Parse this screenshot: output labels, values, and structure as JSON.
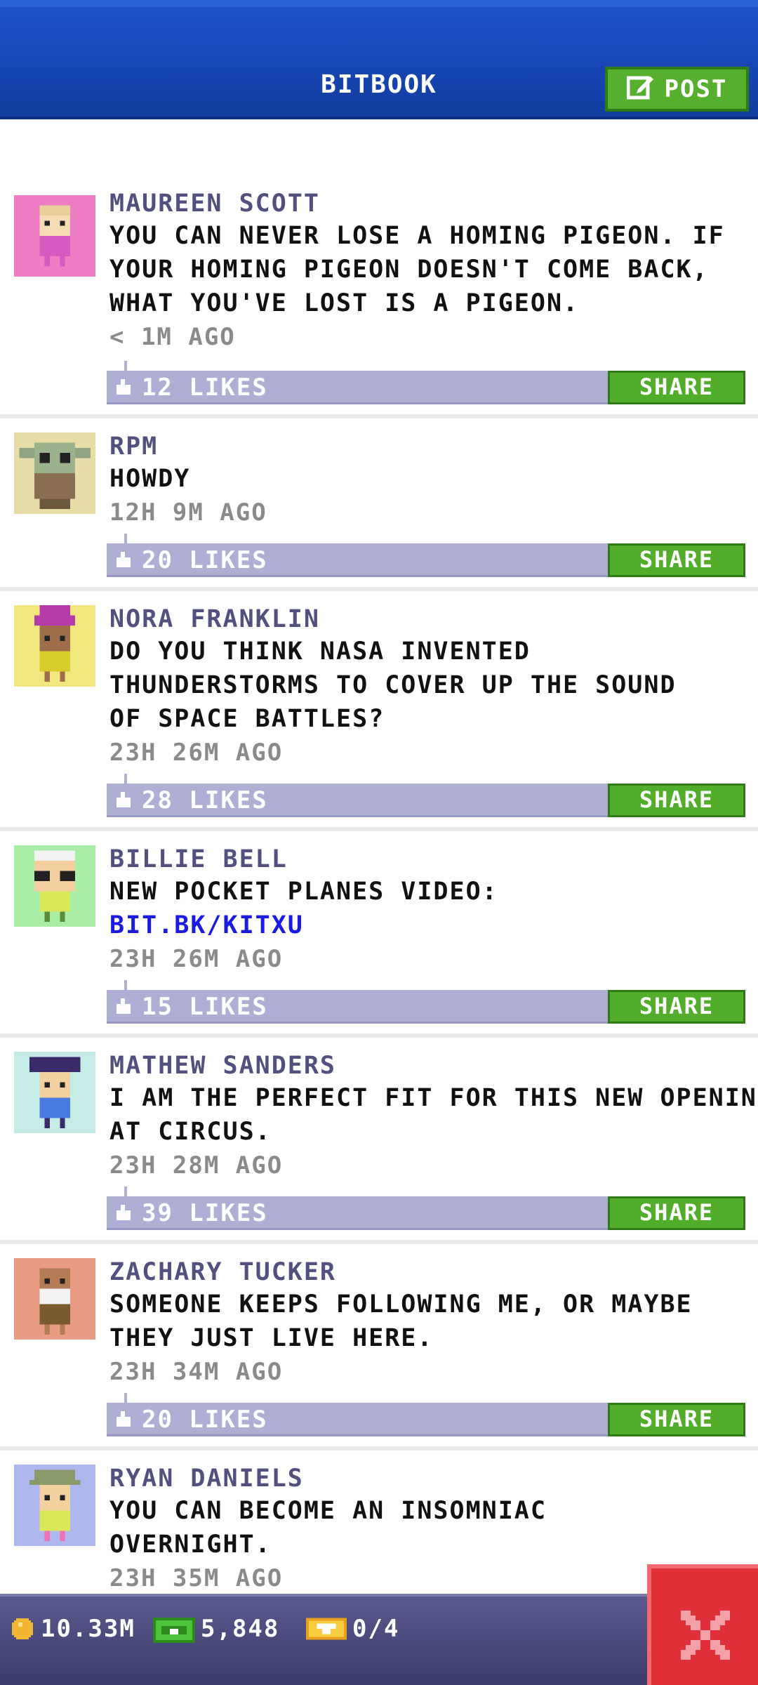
{
  "header": {
    "title": "BITBOOK",
    "post_label": "POST"
  },
  "posts": [
    {
      "name": "MAUREEN SCOTT",
      "lines": [
        "YOU CAN NEVER LOSE A HOMING PIGEON. IF",
        "YOUR HOMING PIGEON DOESN'T COME BACK,",
        "WHAT YOU'VE LOST IS A PIGEON."
      ],
      "time": "< 1M AGO",
      "likes": "12 LIKES",
      "share": "SHARE",
      "avatar_bg": "#f07cc4"
    },
    {
      "name": "RPM",
      "lines": [
        "HOWDY"
      ],
      "time": "12H 9M AGO",
      "likes": "20 LIKES",
      "share": "SHARE",
      "avatar_bg": "#e8dca8"
    },
    {
      "name": "NORA FRANKLIN",
      "lines": [
        "DO YOU THINK NASA INVENTED",
        "THUNDERSTORMS TO COVER UP THE SOUND",
        "OF SPACE BATTLES?"
      ],
      "time": "23H 26M AGO",
      "likes": "28 LIKES",
      "share": "SHARE",
      "avatar_bg": "#f2e67e"
    },
    {
      "name": "BILLIE BELL",
      "lines": [
        "NEW POCKET PLANES VIDEO:"
      ],
      "link": "BIT.BK/KITXU",
      "time": "23H 26M AGO",
      "likes": "15 LIKES",
      "share": "SHARE",
      "avatar_bg": "#a8eea6"
    },
    {
      "name": "MATHEW SANDERS",
      "lines": [
        "I AM THE PERFECT FIT FOR THIS NEW OPENING",
        "AT CIRCUS."
      ],
      "time": "23H 28M AGO",
      "likes": "39 LIKES",
      "share": "SHARE",
      "avatar_bg": "#c6ece8"
    },
    {
      "name": "ZACHARY TUCKER",
      "lines": [
        "SOMEONE KEEPS FOLLOWING ME, OR MAYBE",
        "THEY JUST LIVE HERE."
      ],
      "time": "23H 34M AGO",
      "likes": "20 LIKES",
      "share": "SHARE",
      "avatar_bg": "#e89c86"
    },
    {
      "name": "RYAN DANIELS",
      "lines": [
        "YOU CAN BECOME AN INSOMNIAC",
        "OVERNIGHT."
      ],
      "time": "23H 35M AGO",
      "avatar_bg": "#aeb8ee"
    }
  ],
  "status_bar": {
    "coins": "10.33M",
    "bux": "5,848",
    "tickets": "0/4"
  },
  "icons": {
    "post": "edit-icon",
    "like": "thumb-up-icon",
    "coin": "coin-icon",
    "bux": "bux-icon",
    "ticket": "ticket-icon",
    "close": "close-icon"
  },
  "colors": {
    "header_blue": "#1a4bbd",
    "share_green": "#52ad2b",
    "like_bar": "#afaed4",
    "close_red": "#e0313a",
    "link_blue": "#1a1ae0"
  }
}
